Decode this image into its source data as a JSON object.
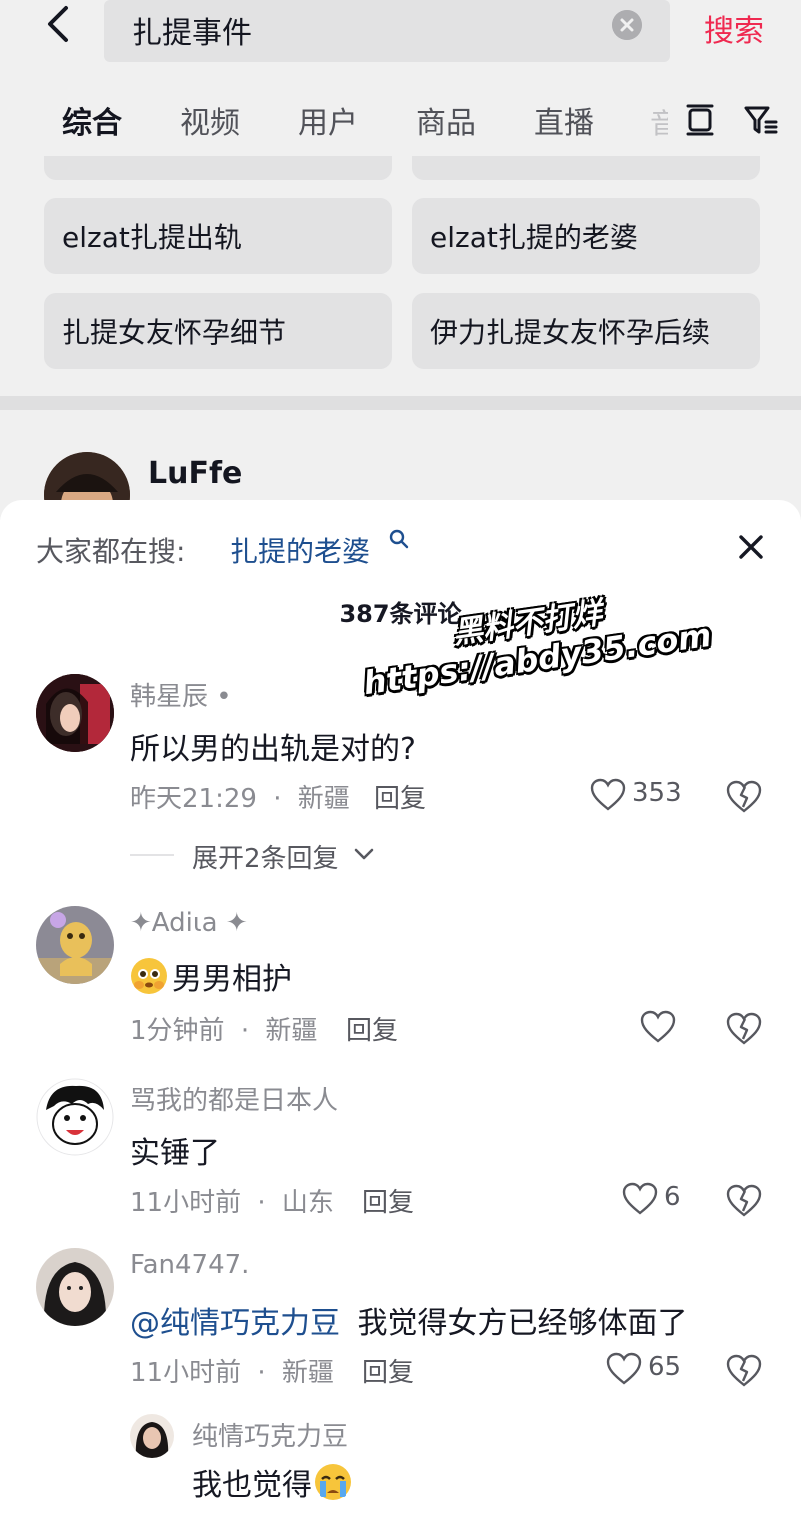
{
  "search": {
    "query": "扎提事件",
    "button_label": "搜索"
  },
  "tabs": [
    {
      "label": "综合",
      "active": true
    },
    {
      "label": "视频",
      "active": false
    },
    {
      "label": "用户",
      "active": false
    },
    {
      "label": "商品",
      "active": false
    },
    {
      "label": "直播",
      "active": false
    }
  ],
  "tabs_more_partial": "音",
  "suggestions": [
    "elzat扎提出轨",
    "elzat扎提的老婆",
    "扎提女友怀孕细节",
    "伊力扎提女友怀孕后续"
  ],
  "result": {
    "name": "LuFfe"
  },
  "sheet": {
    "hot_label": "大家都在搜:",
    "hot_term": "扎提的老婆",
    "count_label": "387条评论"
  },
  "comments": [
    {
      "user": "韩星辰 •",
      "text": "所以男的出轨是对的?",
      "time": "昨天21:29",
      "location": "新疆",
      "reply_label": "回复",
      "likes": "353",
      "expand_label": "展开2条回复"
    },
    {
      "user": "✦Adiιa ✦",
      "text": "男男相护",
      "time": "1分钟前",
      "location": "新疆",
      "reply_label": "回复",
      "likes": ""
    },
    {
      "user": "骂我的都是日本人",
      "text": "实锤了",
      "time": "11小时前",
      "location": "山东",
      "reply_label": "回复",
      "likes": "6"
    },
    {
      "user": "Fan4747.",
      "mention": "@纯情巧克力豆",
      "text": "我觉得女方已经够体面了",
      "time": "11小时前",
      "location": "新疆",
      "reply_label": "回复",
      "likes": "65"
    }
  ],
  "sub_reply": {
    "user": "纯情巧克力豆",
    "text": "我也觉得"
  },
  "meta_separator": "·",
  "watermark": {
    "line1": "黑料不打烊",
    "line2": "https://abdy35.com"
  },
  "colors": {
    "accent": "#fe2c55",
    "link": "#1e4f8f",
    "muted": "#8a8b91"
  }
}
